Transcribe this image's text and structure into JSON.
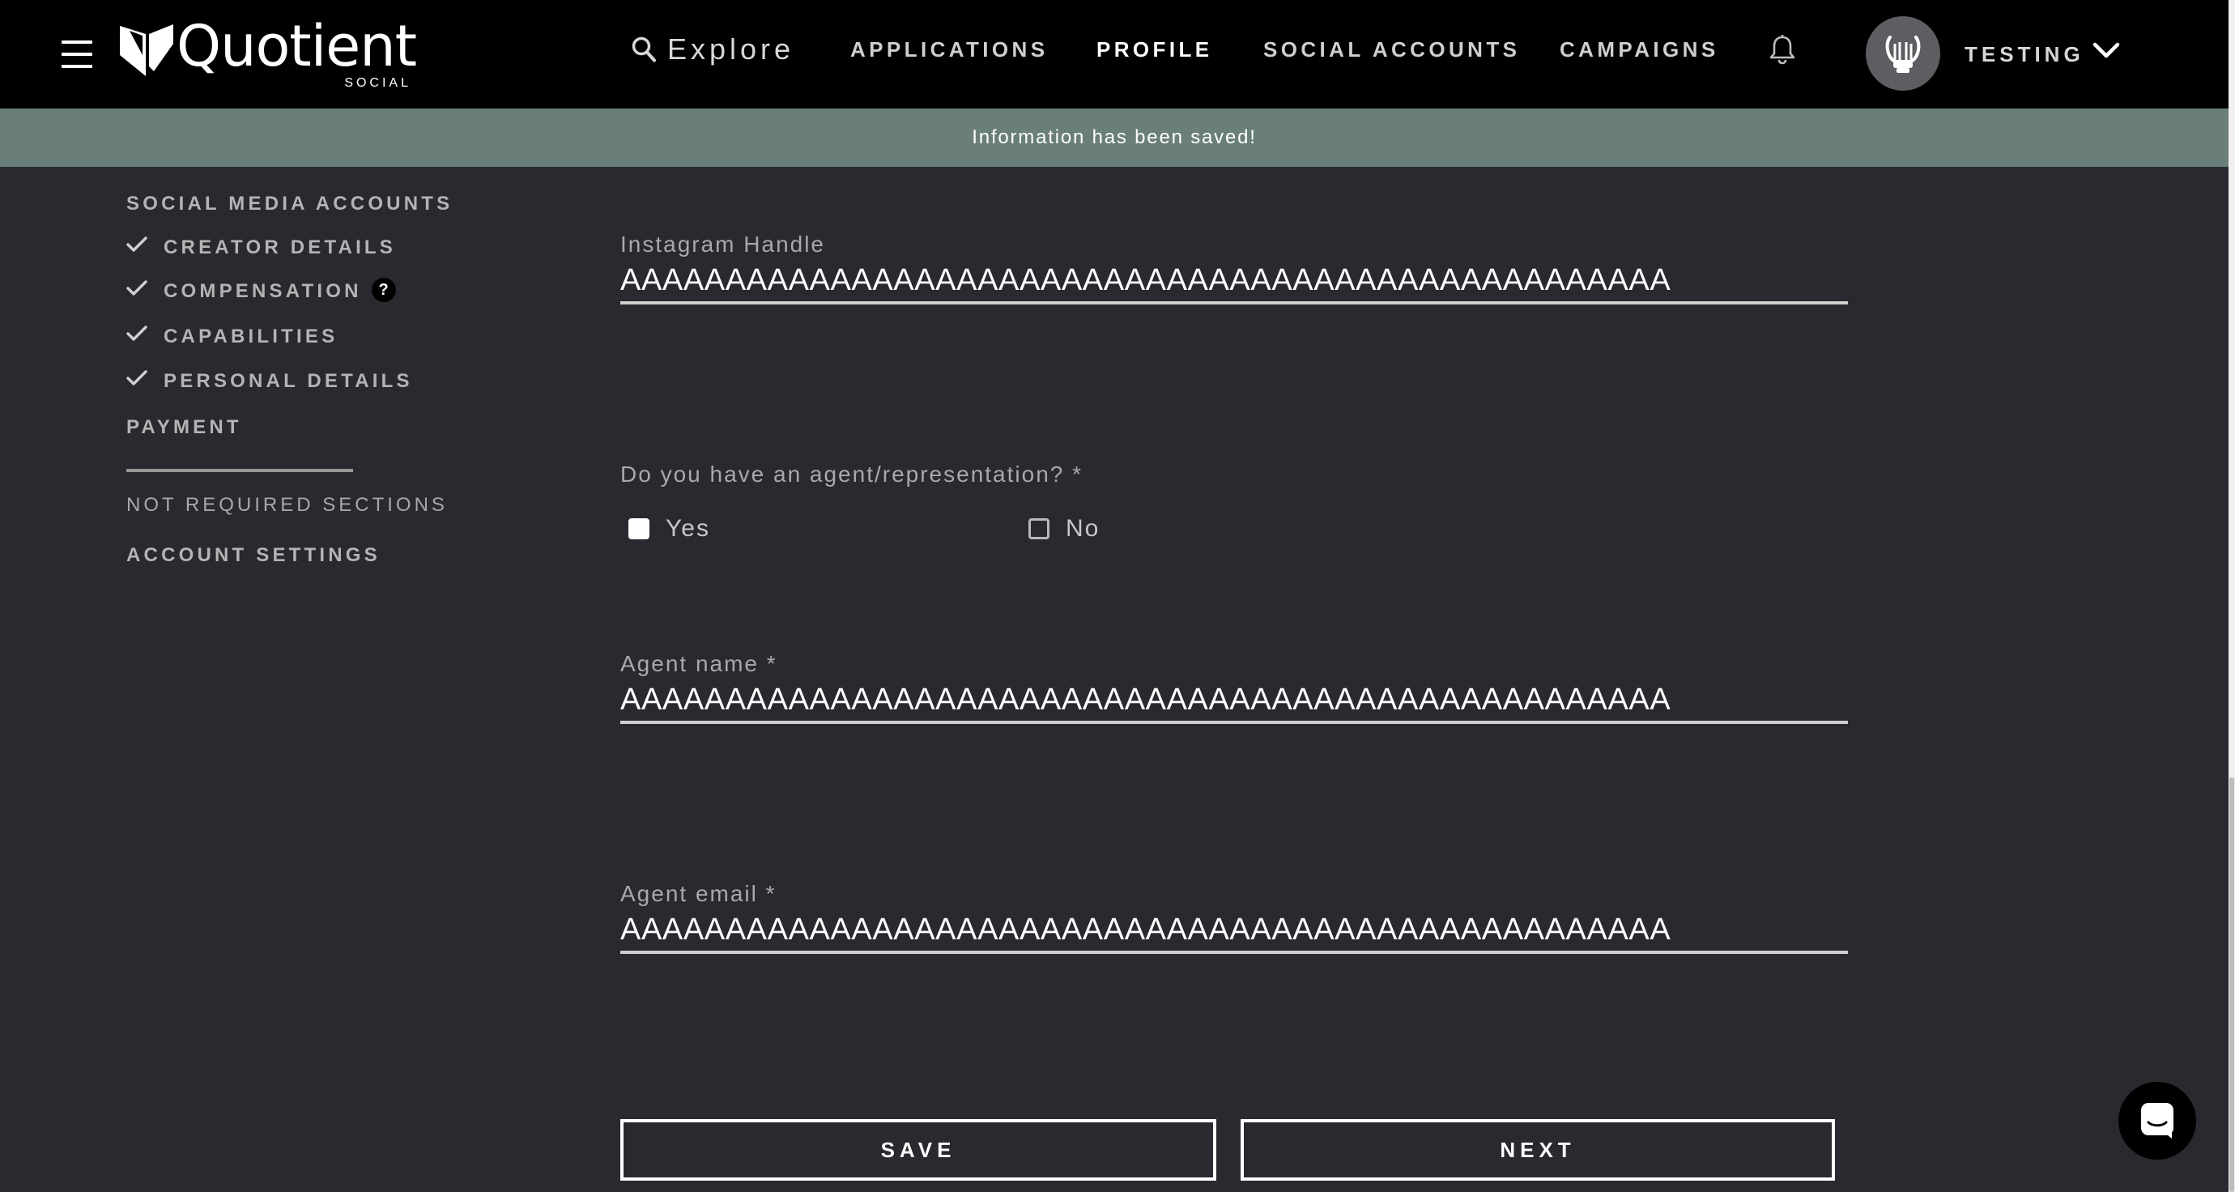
{
  "brand": {
    "name": "Quotient",
    "sub": "SOCIAL"
  },
  "nav": {
    "explore_label": "Explore",
    "links": [
      {
        "label": "APPLICATIONS"
      },
      {
        "label": "PROFILE"
      },
      {
        "label": "SOCIAL ACCOUNTS"
      },
      {
        "label": "CAMPAIGNS"
      }
    ],
    "user_name": "TESTING"
  },
  "banner": {
    "message": "Information has been saved!"
  },
  "sidebar": {
    "items": [
      {
        "label": "SOCIAL MEDIA ACCOUNTS",
        "completed": false
      },
      {
        "label": "CREATOR DETAILS",
        "completed": true
      },
      {
        "label": "COMPENSATION",
        "completed": true,
        "help": "?"
      },
      {
        "label": "CAPABILITIES",
        "completed": true
      },
      {
        "label": "PERSONAL DETAILS",
        "completed": true
      },
      {
        "label": "PAYMENT",
        "completed": false
      }
    ],
    "not_required_label": "NOT REQUIRED SECTIONS",
    "account_settings_label": "ACCOUNT SETTINGS"
  },
  "form": {
    "instagram": {
      "label": "Instagram Handle",
      "value": "AAAAAAAAAAAAAAAAAAAAAAAAAAAAAAAAAAAAAAAAAAAAAAAAAA"
    },
    "agent_question": {
      "label": "Do you have an agent/representation? *",
      "options": [
        {
          "label": "Yes",
          "checked": true
        },
        {
          "label": "No",
          "checked": false
        }
      ]
    },
    "agent_name": {
      "label": "Agent name *",
      "value": "AAAAAAAAAAAAAAAAAAAAAAAAAAAAAAAAAAAAAAAAAAAAAAAAAA"
    },
    "agent_email": {
      "label": "Agent email *",
      "value": "AAAAAAAAAAAAAAAAAAAAAAAAAAAAAAAAAAAAAAAAAAAAAAAAAA"
    },
    "save_label": "SAVE",
    "next_label": "NEXT"
  },
  "colors": {
    "page_bg": "#282a2f",
    "topbar_bg": "#000000",
    "banner_bg": "#6a7f7a"
  },
  "icons": [
    "menu-icon",
    "search-icon",
    "bell-icon",
    "lyre-avatar-icon",
    "chevron-down-icon",
    "check-icon",
    "help-icon",
    "chat-icon"
  ]
}
